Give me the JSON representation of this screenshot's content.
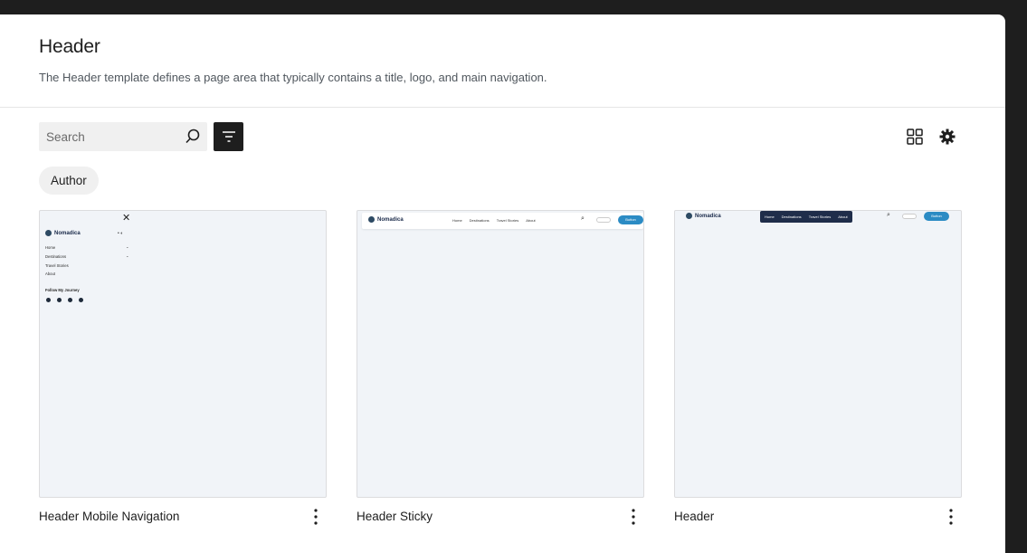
{
  "page": {
    "title": "Header",
    "description": "The Header template defines a page area that typically contains a title, logo, and main navigation."
  },
  "toolbar": {
    "search_placeholder": "Search",
    "search_icon": "search-icon",
    "filter_icon": "filter-icon",
    "view_icon": "grid-view-icon",
    "settings_icon": "gear-icon"
  },
  "filters": {
    "author_chip": "Author"
  },
  "patterns": [
    {
      "title": "Header Mobile Navigation",
      "preview": {
        "site_name": "Nomadica",
        "menu": [
          "Home",
          "Destinations",
          "Travel Stories",
          "About"
        ],
        "follow_heading": "Follow My Journey"
      }
    },
    {
      "title": "Header Sticky",
      "preview": {
        "site_name": "Nomadica",
        "menu": [
          "Home",
          "Destinations",
          "Travel Stories",
          "About"
        ],
        "button": "Button"
      }
    },
    {
      "title": "Header",
      "preview": {
        "site_name": "Nomadica",
        "menu": [
          "Home",
          "Destinations",
          "Travel Stories",
          "About"
        ],
        "button": "Button"
      }
    }
  ],
  "colors": {
    "background": "#1e1e1e",
    "panel": "#ffffff",
    "accent_button": "#2b8bc4",
    "dark_nav": "#1f2d4a",
    "thumb_bg": "#f1f4f8"
  }
}
